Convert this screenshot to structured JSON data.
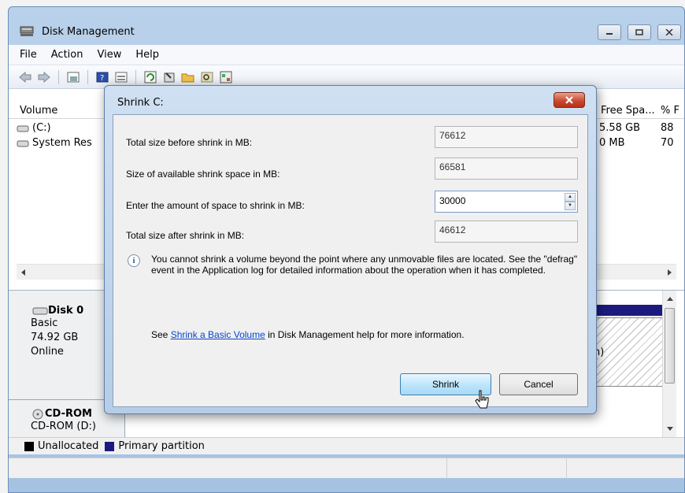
{
  "app": {
    "title": "Disk Management",
    "menu": [
      "File",
      "Action",
      "View",
      "Help"
    ]
  },
  "volume_list": {
    "columns": {
      "volume": "Volume",
      "free_space": "Free Spa...",
      "percent_free": "% F"
    },
    "rows": [
      {
        "volume": "(C:)",
        "free_space": "5.58 GB",
        "percent_free": "88"
      },
      {
        "volume": "System Res",
        "free_space": "0 MB",
        "percent_free": "70"
      }
    ]
  },
  "disks": [
    {
      "name": "Disk 0",
      "type": "Basic",
      "size": "74.92 GB",
      "status": "Online",
      "partition_text": "n)"
    },
    {
      "name": "CD-ROM",
      "drive": "CD-ROM (D:)"
    }
  ],
  "legend": [
    {
      "label": "Unallocated",
      "color": "#000000"
    },
    {
      "label": "Primary partition",
      "color": "#1c1a7f"
    }
  ],
  "dialog": {
    "title": "Shrink C:",
    "close_label": "x",
    "fields": [
      {
        "label": "Total size before shrink in MB:",
        "value": "76612",
        "editable": false
      },
      {
        "label": "Size of available shrink space in MB:",
        "value": "66581",
        "editable": false
      },
      {
        "label": "Enter the amount of space to shrink in MB:",
        "value": "30000",
        "editable": true
      },
      {
        "label": "Total size after shrink in MB:",
        "value": "46612",
        "editable": false
      }
    ],
    "info_text": "You cannot shrink a volume beyond the point where any unmovable files are located. See the \"defrag\" event in the Application log for detailed information about the operation when it has completed.",
    "help_prefix": "See ",
    "help_link": "Shrink a Basic Volume",
    "help_suffix": " in Disk Management help for more information.",
    "shrink_label": "Shrink",
    "cancel_label": "Cancel"
  }
}
